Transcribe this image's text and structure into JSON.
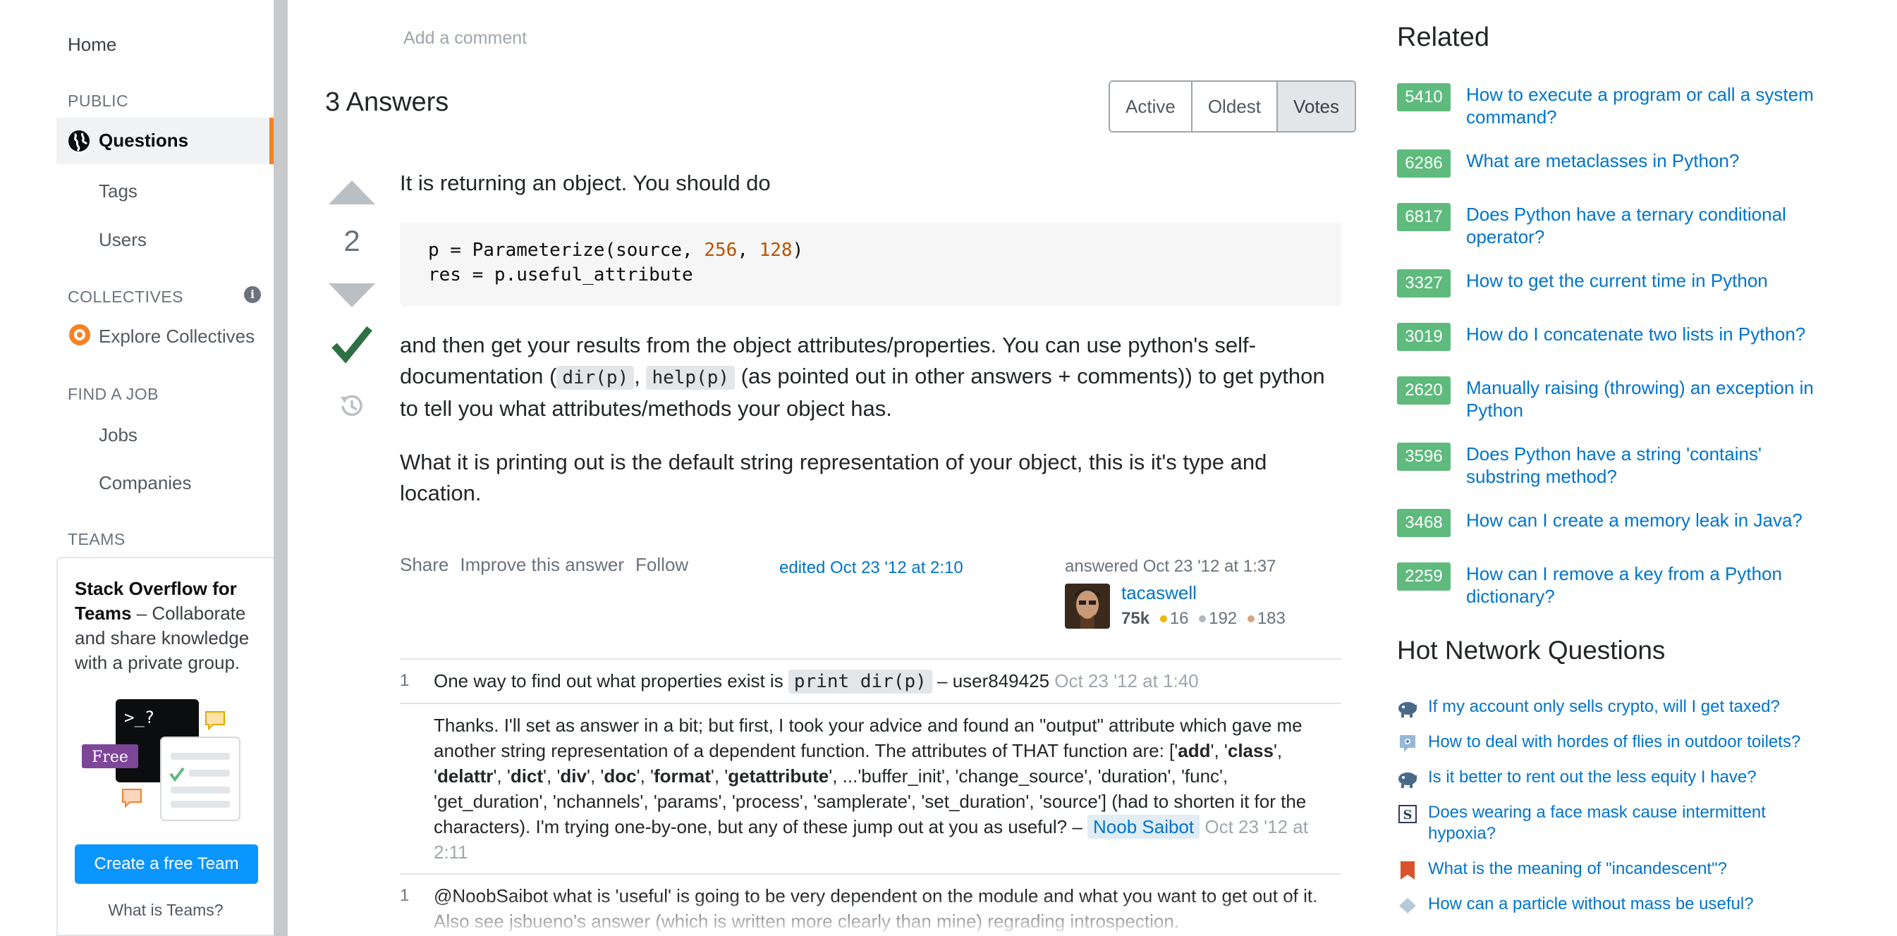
{
  "sidebar": {
    "home": "Home",
    "public_label": "PUBLIC",
    "questions": "Questions",
    "tags": "Tags",
    "users": "Users",
    "collectives_label": "COLLECTIVES",
    "explore_collectives": "Explore Collectives",
    "find_job_label": "FIND A JOB",
    "jobs": "Jobs",
    "companies": "Companies",
    "teams_label": "TEAMS",
    "teams_title": "Stack Overflow for Teams",
    "teams_desc": " – Collaborate and share knowledge with a private group.",
    "illus_prompt": ">_?",
    "free_badge": "Free",
    "create_team_button": "Create a free Team",
    "what_is_teams": "What is Teams?"
  },
  "main": {
    "add_comment": "Add a comment",
    "answers_title": "3 Answers",
    "sort_tabs": [
      {
        "label": "Active",
        "active": false
      },
      {
        "label": "Oldest",
        "active": false
      },
      {
        "label": "Votes",
        "active": true
      }
    ]
  },
  "answer": {
    "score": "2",
    "intro": "It is returning an object. You should do",
    "code": {
      "line1_pre": "p = Parameterize(source, ",
      "line1_n1": "256",
      "line1_sep": ", ",
      "line1_n2": "128",
      "line1_post": ")",
      "line2": "res = p.useful_attribute"
    },
    "para2_a": "and then get your results from the object attributes/properties. You can use python's self-documentation (",
    "para2_code1": "dir(p)",
    "para2_b": ", ",
    "para2_code2": "help(p)",
    "para2_c": " (as pointed out in other answers + comments)) to get python to tell you what attributes/methods your object has.",
    "para3": "What it is printing out is the default string representation of your object, this is it's type and location.",
    "menu": [
      "Share",
      "Improve this answer",
      "Follow"
    ],
    "edited": "edited Oct 23 '12 at 2:10",
    "answered": "answered Oct 23 '12 at 1:37",
    "user": {
      "name": "tacaswell",
      "reputation": "75k",
      "gold": "16",
      "silver": "192",
      "bronze": "183"
    }
  },
  "comments": [
    {
      "score": "1",
      "text": "One way to find out what properties exist is ",
      "code": "print dir(p)",
      "dash": " – ",
      "user": "user849425",
      "date": " Oct 23 '12 at 1:40"
    },
    {
      "score": "",
      "text_a": "Thanks. I'll set as answer in a bit; but first, I took your advice and found an \"output\" attribute which gave me another string representation of a dependent function. The attributes of THAT function are: ['",
      "b1": "add",
      "s1": "', '",
      "b2": "class",
      "b3": "delattr",
      "b4": "dict",
      "b5": "div",
      "b6": "doc",
      "b7": "format",
      "b8": "getattribute",
      "text_b": "', ...'buffer_init', 'change_source', 'duration', 'func', 'get_duration', 'nchannels', 'params', 'process', 'samplerate', 'set_duration', 'source'] (had to shorten it for the characters). I'm trying one-by-one, but any of these jump out at you as useful? – ",
      "user": "Noob Saibot",
      "date": " Oct 23 '12 at 2:11"
    },
    {
      "score": "1",
      "text": "@NoobSaibot what is 'useful' is going to be very dependent on the module and what you want to get out of it. Also see jsbueno's answer (which is written more clearly than mine) regrading introspection."
    }
  ],
  "related": {
    "title": "Related",
    "items": [
      {
        "votes": "5410",
        "title": "How to execute a program or call a system command?"
      },
      {
        "votes": "6286",
        "title": "What are metaclasses in Python?"
      },
      {
        "votes": "6817",
        "title": "Does Python have a ternary conditional operator?"
      },
      {
        "votes": "3327",
        "title": "How to get the current time in Python"
      },
      {
        "votes": "3019",
        "title": "How do I concatenate two lists in Python?"
      },
      {
        "votes": "2620",
        "title": "Manually raising (throwing) an exception in Python"
      },
      {
        "votes": "3596",
        "title": "Does Python have a string 'contains' substring method?"
      },
      {
        "votes": "3468",
        "title": "How can I create a memory leak in Java?"
      },
      {
        "votes": "2259",
        "title": "How can I remove a key from a Python dictionary?"
      }
    ]
  },
  "hot": {
    "title": "Hot Network Questions",
    "items": [
      {
        "icon": "money-stackexchange-icon",
        "title": "If my account only sells crypto, will I get taxed?"
      },
      {
        "icon": "outdoors-stackexchange-icon",
        "title": "How to deal with hordes of flies in outdoor toilets?"
      },
      {
        "icon": "money-stackexchange-icon",
        "title": "Is it better to rent out the less equity I have?"
      },
      {
        "icon": "skeptics-stackexchange-icon",
        "title": "Does wearing a face mask cause intermittent hypoxia?"
      },
      {
        "icon": "english-stackexchange-icon",
        "title": "What is the meaning of \"incandescent\"?"
      },
      {
        "icon": "physics-stackexchange-icon",
        "title": "How can a particle without mass be useful?"
      }
    ]
  },
  "colors": {
    "link": "#0074cc",
    "accent": "#f48225",
    "accepted": "#2f6f44",
    "vote_badge": "#5eba7d",
    "button": "#0a95ff"
  }
}
